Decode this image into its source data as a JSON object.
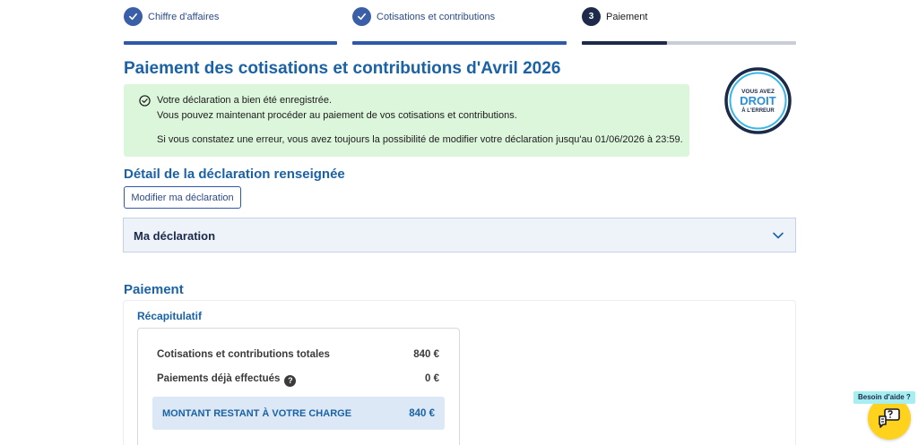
{
  "stepper": {
    "steps": [
      {
        "label": "Chiffre d'affaires",
        "state": "done"
      },
      {
        "label": "Cotisations et contributions",
        "state": "done"
      },
      {
        "label": "Paiement",
        "number": "3",
        "state": "current"
      }
    ]
  },
  "page": {
    "title": "Paiement des cotisations et contributions d'Avril 2026"
  },
  "alert": {
    "line1": "Votre déclaration a bien été enregistrée.",
    "line2": "Vous pouvez maintenant procéder au paiement de vos cotisations et contributions.",
    "line3": "Si vous constatez une erreur, vous avez toujours la possibilité de modifier votre déclaration jusqu'au 01/06/2026 à 23:59."
  },
  "badge": {
    "line1": "VOUS AVEZ",
    "line2": "DROIT",
    "line3": "À L'ERREUR"
  },
  "detail": {
    "title": "Détail de la déclaration renseignée",
    "edit_button": "Modifier ma déclaration",
    "accordion_title": "Ma déclaration"
  },
  "payment": {
    "title": "Paiement",
    "recap_title": "Récapitulatif",
    "rows": [
      {
        "label": "Cotisations et contributions totales",
        "value": "840 €"
      },
      {
        "label": "Paiements déjà effectués",
        "value": "0 €"
      }
    ],
    "total_label": "MONTANT RESTANT À VOTRE CHARGE",
    "total_value": "840 €",
    "help_icon": "?"
  },
  "help": {
    "label": "Besoin d'aide ?"
  },
  "colors": {
    "primary": "#1a62a5",
    "step_done": "#3a5ea8",
    "step_current": "#1e2a4a",
    "alert_bg": "#dcf6dc",
    "help_fab": "#ffd21e"
  }
}
